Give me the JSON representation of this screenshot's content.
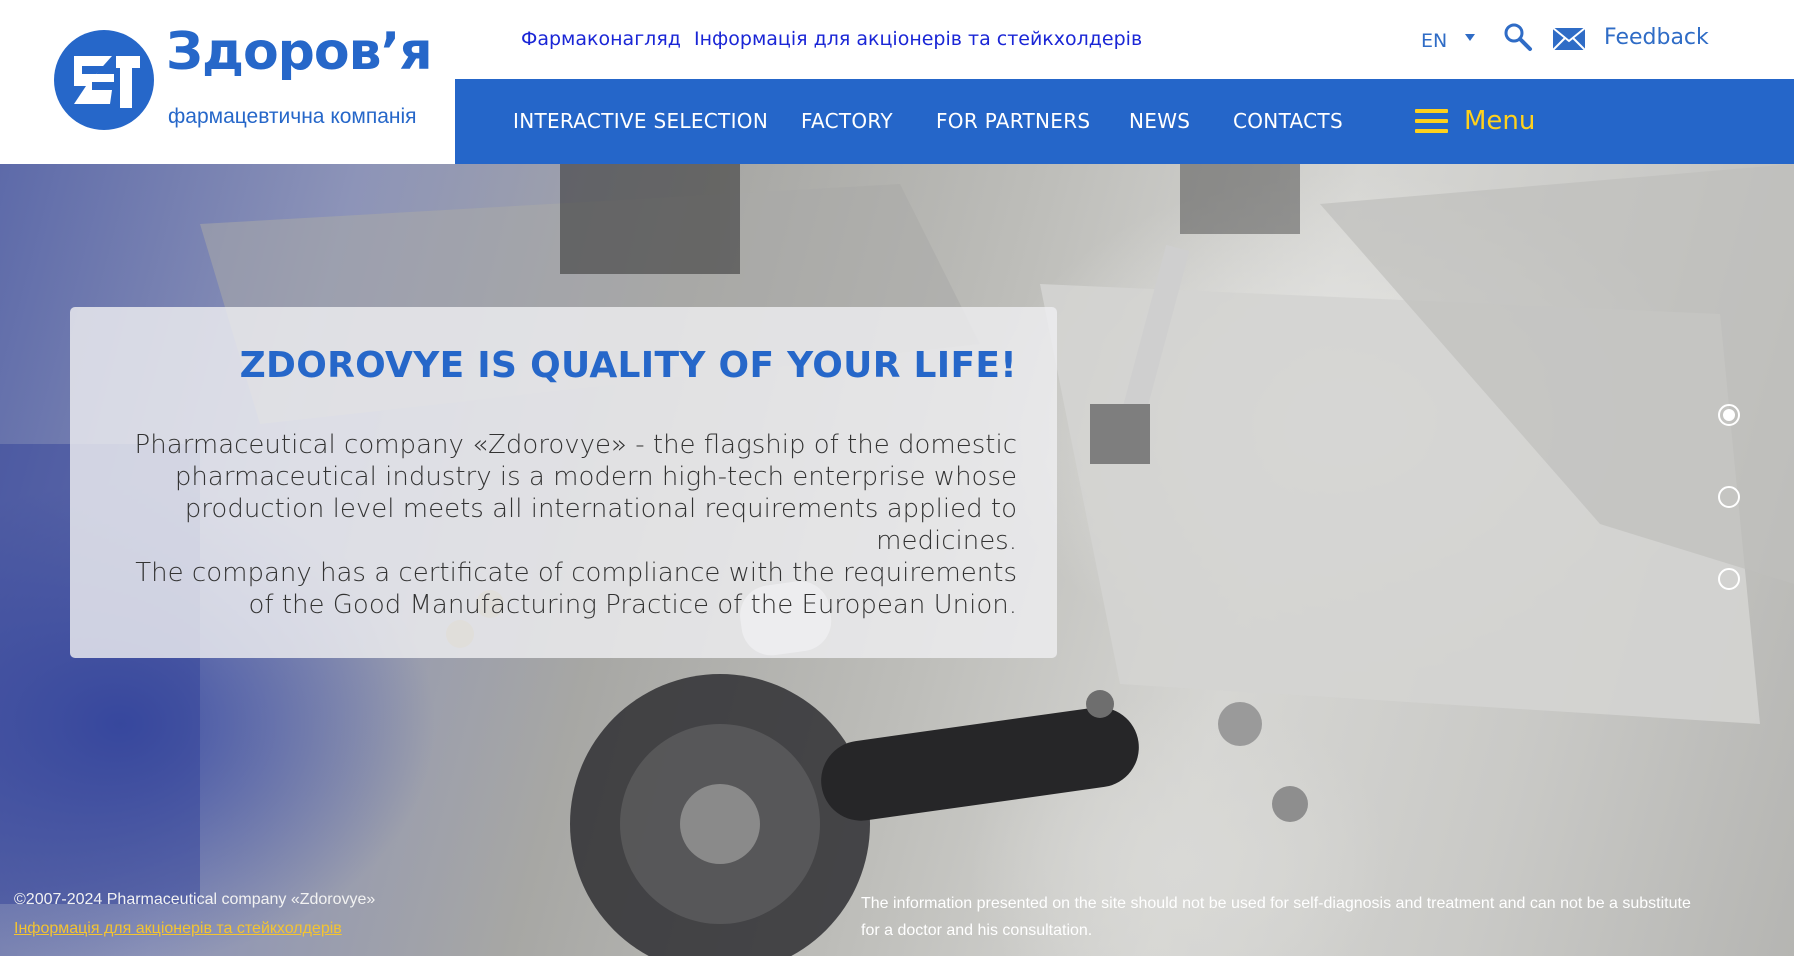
{
  "brand": {
    "name": "Здоров’я",
    "subtitle": "фармацевтична компанія",
    "logo_icon": "zt-logo-icon",
    "primary_color": "#2566c9",
    "accent_color": "#ffd11c"
  },
  "top_links": [
    {
      "label": "Фармаконагляд"
    },
    {
      "label": "Інформація для акціонерів та стейкхолдерів"
    }
  ],
  "utility": {
    "language": "EN",
    "search_icon": "search-icon",
    "mail_icon": "mail-icon",
    "feedback_label": "Feedback"
  },
  "nav": {
    "items": [
      {
        "label": "INTERACTIVE SELECTION"
      },
      {
        "label": "FACTORY"
      },
      {
        "label": "FOR PARTNERS"
      },
      {
        "label": "NEWS"
      },
      {
        "label": "CONTACTS"
      }
    ],
    "menu_label": "Menu"
  },
  "hero": {
    "title": "ZDOROVYE IS QUALITY OF YOUR LIFE!",
    "paragraph1": "Pharmaceutical company «Zdorovye» - the flagship of the domestic pharmaceutical industry is a modern high-tech enterprise whose production level meets all international requirements applied to medicines.",
    "paragraph2": "The company has a certificate of compliance with the requirements of the Good Manufacturing Practice of the European Union.",
    "slides_total": 3,
    "active_slide": 1
  },
  "footer": {
    "copyright": "©2007-2024 Pharmaceutical company «Zdorovye»",
    "stakeholders_link": "Інформація для акціонерів та стейкхолдерів",
    "disclaimer": "The information presented on the site should not be used for self-diagnosis and treatment and can not be a substitute for a doctor and his consultation."
  }
}
